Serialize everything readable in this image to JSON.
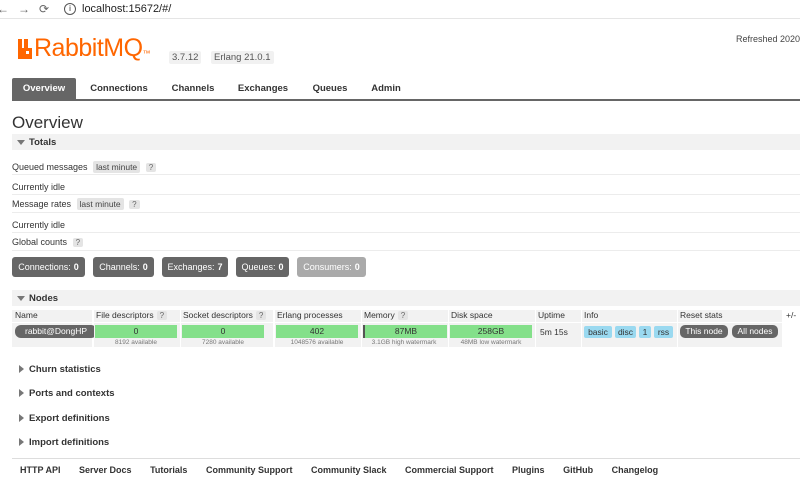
{
  "browser": {
    "url": "localhost:15672/#/",
    "back_icon": "←",
    "forward_icon": "→",
    "reload_icon": "⟳"
  },
  "header": {
    "logo_text": "RabbitMQ",
    "logo_tm": "™",
    "version": "3.7.12",
    "erlang": "Erlang 21.0.1",
    "refreshed": "Refreshed 2020",
    "brand_color": "#ff6600"
  },
  "tabs": [
    "Overview",
    "Connections",
    "Channels",
    "Exchanges",
    "Queues",
    "Admin"
  ],
  "page_title": "Overview",
  "totals": {
    "label": "Totals",
    "queued_messages": "Queued messages",
    "queued_range": "last minute",
    "help": "?",
    "idle1": "Currently idle",
    "message_rates": "Message rates",
    "rates_range": "last minute",
    "idle2": "Currently idle",
    "global_counts": "Global counts"
  },
  "counts": [
    {
      "label": "Connections:",
      "value": "0"
    },
    {
      "label": "Channels:",
      "value": "0"
    },
    {
      "label": "Exchanges:",
      "value": "7"
    },
    {
      "label": "Queues:",
      "value": "0"
    },
    {
      "label": "Consumers:",
      "value": "0"
    }
  ],
  "nodes": {
    "label": "Nodes",
    "headers": [
      "Name",
      "File descriptors",
      "Socket descriptors",
      "Erlang processes",
      "Memory",
      "Disk space",
      "Uptime",
      "Info",
      "Reset stats",
      "+/-"
    ],
    "row": {
      "name": "rabbit@DongHP",
      "fd": "0",
      "fd_sub": "8192 available",
      "sd": "0",
      "sd_sub": "7280 available",
      "ep": "402",
      "ep_sub": "1048576 available",
      "mem": "87MB",
      "mem_sub": "3.1GB high watermark",
      "disk": "258GB",
      "disk_sub": "48MB low watermark",
      "uptime": "5m 15s",
      "info": [
        "basic",
        "disc",
        "1",
        "rss"
      ],
      "reset": [
        "This node",
        "All nodes"
      ]
    }
  },
  "collapsed_sections": [
    "Churn statistics",
    "Ports and contexts",
    "Export definitions",
    "Import definitions"
  ],
  "footer": [
    "HTTP API",
    "Server Docs",
    "Tutorials",
    "Community Support",
    "Community Slack",
    "Commercial Support",
    "Plugins",
    "GitHub",
    "Changelog"
  ]
}
